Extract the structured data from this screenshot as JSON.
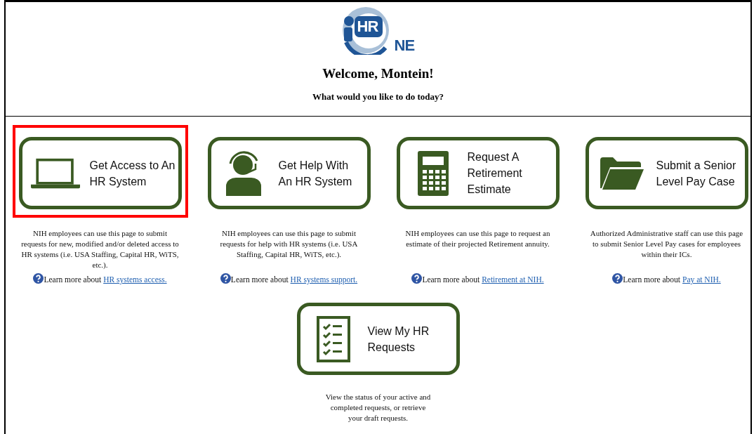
{
  "logo": {
    "inner": "HR",
    "outer": "NE"
  },
  "welcome": "Welcome, Montein!",
  "prompt": "What would you like to do today?",
  "tiles": [
    {
      "kind": "laptop",
      "label": "Get Access to An HR System",
      "highlighted": true,
      "description": "NIH employees can use this page to submit requests for new, modified and/or deleted access to HR systems (i.e. USA Staffing, Capital HR, WiTS, etc.).",
      "learn_prefix": "Learn more about",
      "learn_link": "HR systems access."
    },
    {
      "kind": "headset",
      "label": "Get Help With An HR System",
      "highlighted": false,
      "description": "NIH employees can use this page to submit requests for help with HR systems (i.e. USA Staffing, Capital HR, WiTS, etc.).",
      "learn_prefix": "Learn more about",
      "learn_link": "HR systems support."
    },
    {
      "kind": "calculator",
      "label": "Request A Retirement Estimate",
      "highlighted": false,
      "description": "NIH employees can use this page to request an estimate of their projected Retirement annuity.",
      "learn_prefix": "Learn more about",
      "learn_link": "Retirement at NIH."
    },
    {
      "kind": "folder",
      "label": "Submit a Senior Level Pay Case",
      "highlighted": false,
      "description": "Authorized Administrative staff can use this page to submit Senior Level Pay cases for employees within their ICs.",
      "learn_prefix": "Learn more about",
      "learn_link": "Pay at NIH."
    },
    {
      "kind": "checklist",
      "label": "View My HR Requests",
      "highlighted": false,
      "description": "View the status of your active and completed requests, or retrieve your draft requests."
    }
  ]
}
